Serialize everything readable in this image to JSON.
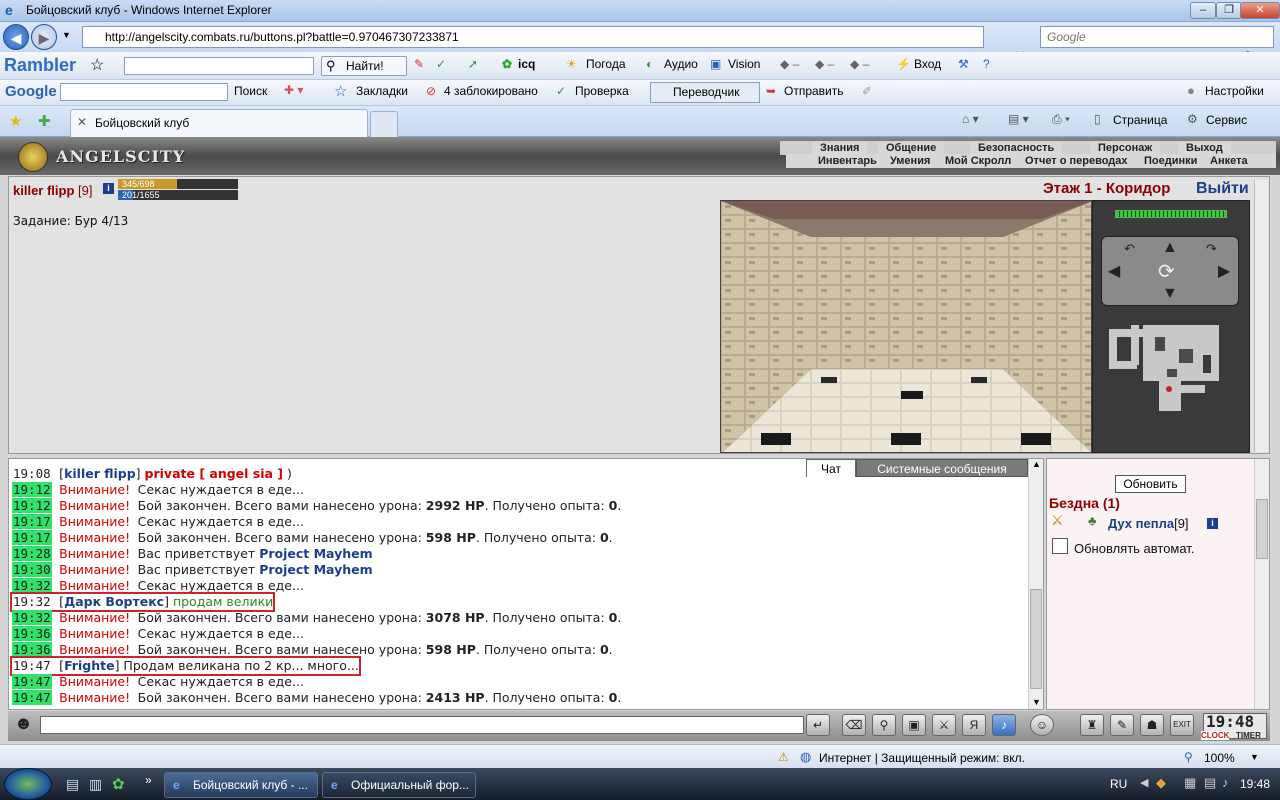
{
  "window": {
    "title": "Бойцовский клуб - Windows Internet Explorer",
    "controls": [
      "–",
      "❐",
      "✕"
    ]
  },
  "address_bar": {
    "url": "http://angelscity.combats.ru/buttons.pl?battle=0.970467307233871",
    "search_placeholder": "Google"
  },
  "rambler_toolbar": {
    "brand": "Rambler",
    "find_label": "Найти!",
    "icq": "icq",
    "weather": "Погода",
    "audio": "Аудио",
    "vision": "Vision",
    "login": "Вход"
  },
  "google_toolbar": {
    "brand": "Google",
    "search_label": "Поиск",
    "bookmarks": "Закладки",
    "blocked": "4 заблокировано",
    "check": "Проверка",
    "translator": "Переводчик",
    "send": "Отправить",
    "settings": "Настройки"
  },
  "tabs": {
    "active": "Бойцовский клуб",
    "page": "Страница",
    "service": "Сервис"
  },
  "game_menu": {
    "logo": "ANGELSCITY",
    "row1": [
      "Знания",
      "Общение",
      "Безопасность",
      "Персонаж",
      "Выход"
    ],
    "row2": [
      "Инвентарь",
      "Умения",
      "Мой Скролл",
      "Отчет о переводах",
      "Поединки",
      "Анкета"
    ]
  },
  "player": {
    "name": "killer flipp",
    "level": "[9]",
    "hp": "345/698",
    "hp_fraction": 0.494,
    "mana": "201/1655",
    "mana_fraction": 0.121,
    "task": "Задание: Бур 4/13"
  },
  "location": {
    "floor": "Этаж 1 - Коридор",
    "exit": "Выйти"
  },
  "chat": {
    "tabs": [
      "Чат",
      "Системные сообщения"
    ],
    "lines": [
      {
        "time": "19:08",
        "kind": "private",
        "from": "killer flipp",
        "privlabel": "private [ angel sia ]",
        "text": ")"
      },
      {
        "time": "19:12",
        "kind": "warn",
        "warn": "Внимание!",
        "text": "Секас нуждается в еде..."
      },
      {
        "time": "19:12",
        "kind": "battle",
        "warn": "Внимание!",
        "pre": "Бой закончен. Всего вами нанесено урона:",
        "dmg": "2992 HP",
        "mid": ". Получено опыта:",
        "exp": "0",
        "end": "."
      },
      {
        "time": "19:17",
        "kind": "warn",
        "warn": "Внимание!",
        "text": "Секас нуждается в еде..."
      },
      {
        "time": "19:17",
        "kind": "battle",
        "warn": "Внимание!",
        "pre": "Бой закончен. Всего вами нанесено урона:",
        "dmg": "598 HP",
        "mid": ". Получено опыта:",
        "exp": "0",
        "end": "."
      },
      {
        "time": "19:28",
        "kind": "greet",
        "warn": "Внимание!",
        "text": "Вас приветствует",
        "who": "Project Mayhem"
      },
      {
        "time": "19:30",
        "kind": "greet",
        "warn": "Внимание!",
        "text": "Вас приветствует",
        "who": "Project Mayhem"
      },
      {
        "time": "19:32",
        "kind": "warn",
        "warn": "Внимание!",
        "text": "Секас нуждается в еде..."
      },
      {
        "time": "19:32",
        "kind": "say",
        "from": "Дарк Вортекс",
        "text": "продам велики",
        "green": true
      },
      {
        "time": "19:32",
        "kind": "battle",
        "warn": "Внимание!",
        "pre": "Бой закончен. Всего вами нанесено урона:",
        "dmg": "3078 HP",
        "mid": ". Получено опыта:",
        "exp": "0",
        "end": "."
      },
      {
        "time": "19:36",
        "kind": "warn",
        "warn": "Внимание!",
        "text": "Секас нуждается в еде..."
      },
      {
        "time": "19:36",
        "kind": "battle",
        "warn": "Внимание!",
        "pre": "Бой закончен. Всего вами нанесено урона:",
        "dmg": "598 HP",
        "mid": ". Получено опыта:",
        "exp": "0",
        "end": "."
      },
      {
        "time": "19:47",
        "kind": "say",
        "from": "Frighte",
        "text": "Продам великана по 2 кр... много...",
        "green": false
      },
      {
        "time": "19:47",
        "kind": "warn",
        "warn": "Внимание!",
        "text": "Секас нуждается в еде..."
      },
      {
        "time": "19:47",
        "kind": "battle",
        "warn": "Внимание!",
        "pre": "Бой закончен. Всего вами нанесено урона:",
        "dmg": "2413 HP",
        "mid": ". Получено опыта:",
        "exp": "0",
        "end": "."
      }
    ]
  },
  "right_panel": {
    "refresh": "Обновить",
    "room": "Бездна (1)",
    "creature": "Дух пепла",
    "creature_level": "[9]",
    "auto_refresh": "Обновлять автомат."
  },
  "clock": {
    "time": "19:48",
    "labels": [
      "CLOCK",
      "TIMER"
    ]
  },
  "status_bar": {
    "zone": "Интернет | Защищенный режим: вкл.",
    "zoom": "100%"
  },
  "taskbar": {
    "tasks": [
      "Бойцовский клуб - ...",
      "Официальный фор..."
    ],
    "lang": "RU",
    "time": "19:48"
  },
  "colors": {
    "time_highlight": "#2fe36a",
    "warn": "#d40000",
    "nick": "#1b3f8b",
    "highlight_box": "#d0222a"
  }
}
